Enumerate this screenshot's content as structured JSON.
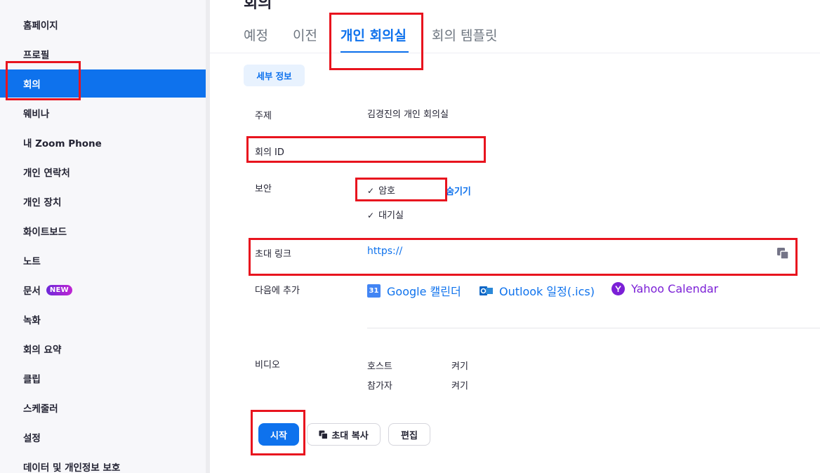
{
  "sidebar": {
    "items": [
      {
        "label": "홈페이지",
        "active": false
      },
      {
        "label": "프로필",
        "active": false
      },
      {
        "label": "회의",
        "active": true
      },
      {
        "label": "웨비나",
        "active": false
      },
      {
        "label": "내 Zoom Phone",
        "active": false
      },
      {
        "label": "개인 연락처",
        "active": false
      },
      {
        "label": "개인 장치",
        "active": false
      },
      {
        "label": "화이트보드",
        "active": false
      },
      {
        "label": "노트",
        "active": false
      },
      {
        "label": "문서",
        "active": false,
        "badge": "NEW"
      },
      {
        "label": "녹화",
        "active": false
      },
      {
        "label": "회의 요약",
        "active": false
      },
      {
        "label": "클립",
        "active": false
      },
      {
        "label": "스케줄러",
        "active": false
      },
      {
        "label": "설정",
        "active": false
      },
      {
        "label": "데이터 및 개인정보 보호",
        "active": false
      }
    ]
  },
  "page": {
    "title": "회의"
  },
  "tabs": [
    {
      "label": "예정",
      "active": false
    },
    {
      "label": "이전",
      "active": false
    },
    {
      "label": "개인 회의실",
      "active": true
    },
    {
      "label": "회의 템플릿",
      "active": false
    }
  ],
  "subtab": {
    "label": "세부 정보"
  },
  "details": {
    "topic_label": "주제",
    "topic_value": "김경진의 개인 회의실",
    "meeting_id_label": "회의 ID",
    "security_label": "보안",
    "passcode_label": "암호",
    "hide_link": "숨기기",
    "waiting_room_label": "대기실",
    "invite_link_label": "초대 링크",
    "invite_link_value": "https://",
    "add_to_label": "다음에 추가",
    "calendars": [
      "Google 캘린더",
      "Outlook 일정(.ics)",
      "Yahoo Calendar"
    ],
    "google_icon_text": "31",
    "video_label": "비디오",
    "host_label": "호스트",
    "host_value": "켜기",
    "participant_label": "참가자",
    "participant_value": "켜기"
  },
  "buttons": {
    "start": "시작",
    "copy_invite": "초대 복사",
    "edit": "편집"
  },
  "colors": {
    "accent": "#0e72ed",
    "annotation": "#e8141e",
    "yahoo": "#7b1fd6",
    "outlook": "#0a64c4"
  }
}
